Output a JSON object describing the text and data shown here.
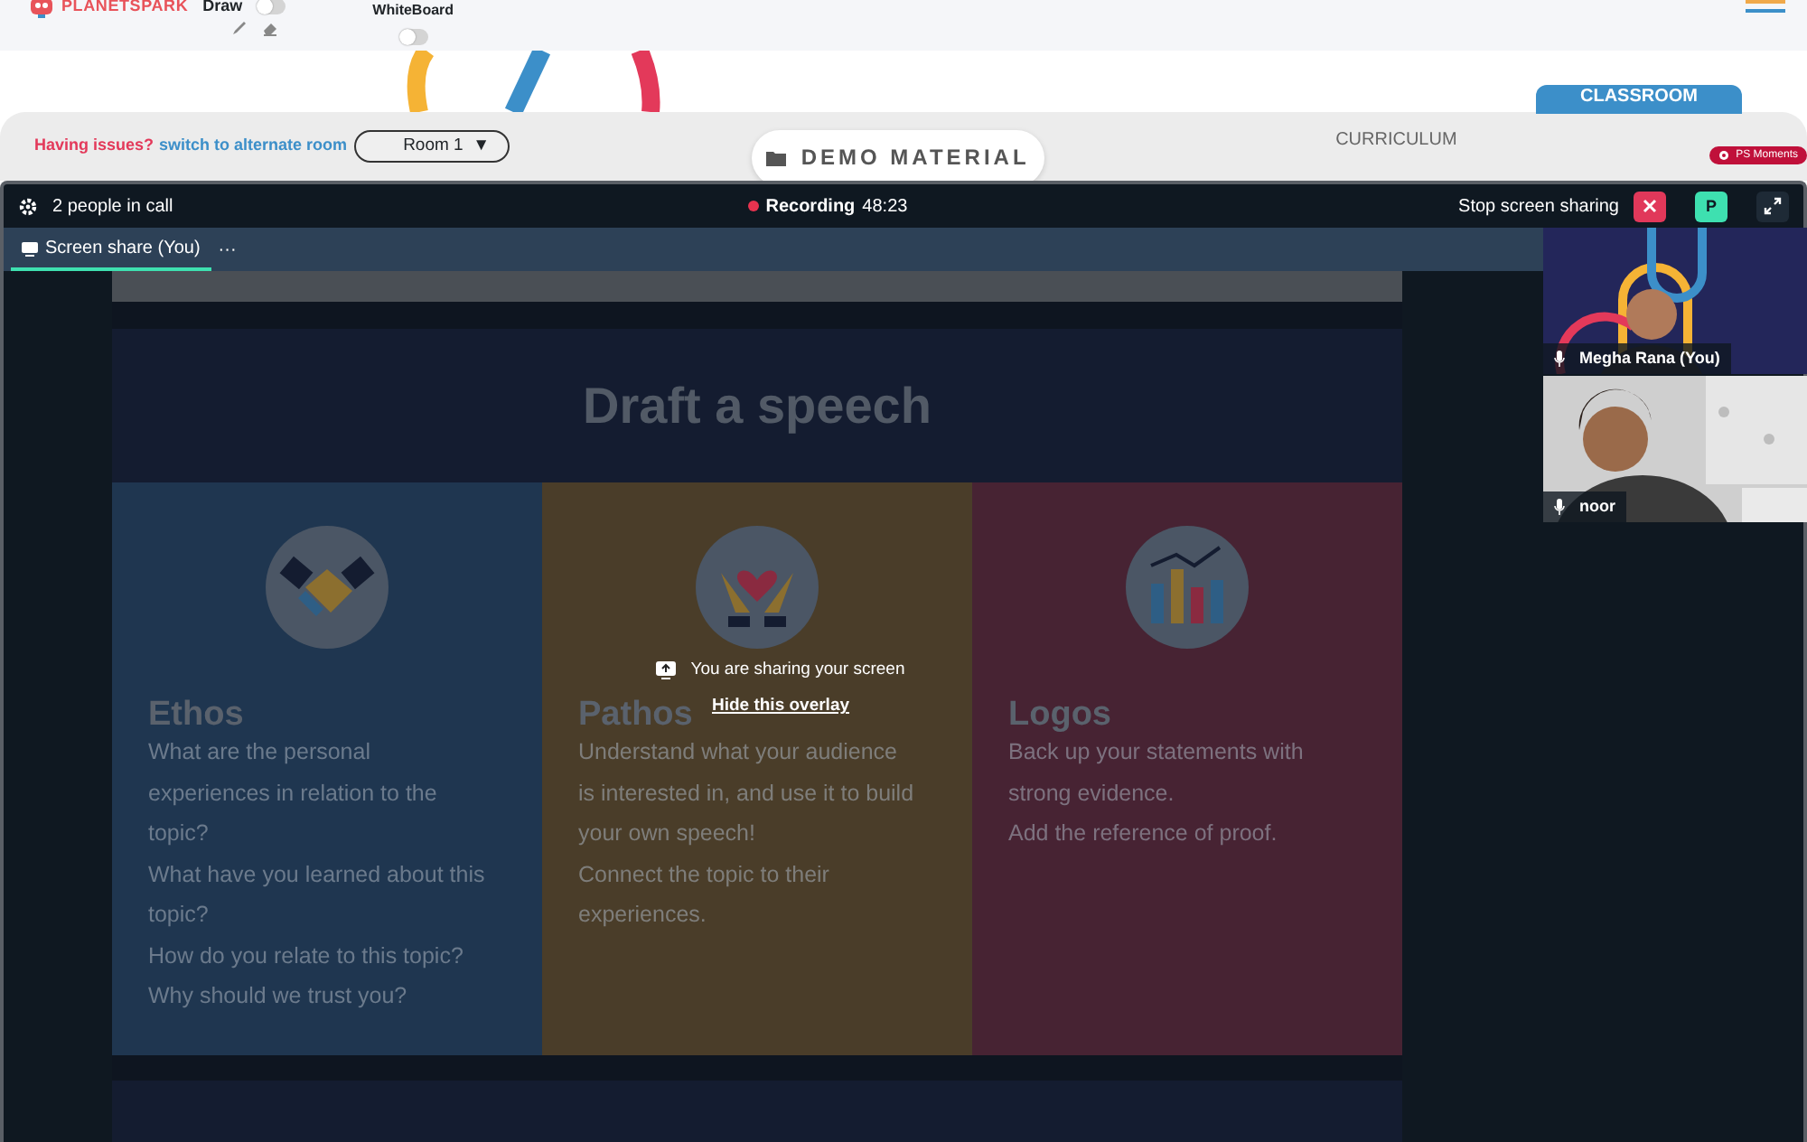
{
  "header": {
    "logo": "PLANETSPARK",
    "draw": {
      "label": "Draw",
      "on": false
    },
    "whiteboard": {
      "label": "WhiteBoard",
      "on": false
    }
  },
  "nav": {
    "issues_text": "Having issues?",
    "switch_link": "switch to alternate room",
    "room": "Room 1",
    "caret": "▼",
    "tabs": [
      {
        "label": "DEMO MATERIAL",
        "selected": true
      },
      {
        "label": "CURRICULUM",
        "selected": false
      }
    ],
    "section_label": "CLASSROOM",
    "ps_moments": "PS Moments"
  },
  "call": {
    "people": "2 people in call",
    "recording": {
      "on": true,
      "label": "Recording",
      "time": "48:23"
    },
    "stop_share": "Stop screen sharing",
    "avatar_letter": "P",
    "share_tab": {
      "label": "Screen share (You)",
      "more": "···",
      "selected": true
    },
    "slide": {
      "title": "Draft a speech",
      "columns": [
        {
          "heading": "Ethos",
          "kind": "handshake",
          "color": "#1f3650",
          "paragraphs": [
            "What are the personal experiences in relation to the topic?",
            "What have you learned about this topic?",
            "How do you relate to this topic?",
            "Why should we trust you?"
          ]
        },
        {
          "heading": "Pathos",
          "kind": "heart",
          "color": "#4a3d29",
          "paragraphs": [
            "Understand what your audience is interested in, and use it to build your own speech!",
            "Connect the topic to their experiences."
          ]
        },
        {
          "heading": "Logos",
          "kind": "chart",
          "color": "#472333",
          "paragraphs": [
            "Back up your statements with strong evidence.",
            "Add the reference of proof."
          ]
        }
      ]
    },
    "overlay": {
      "text": "You are sharing your screen",
      "link": "Hide this overlay"
    },
    "participants": [
      {
        "name": "Megha Rana (You)",
        "kind": "picture"
      },
      {
        "name": "noor",
        "kind": "picture"
      }
    ]
  }
}
